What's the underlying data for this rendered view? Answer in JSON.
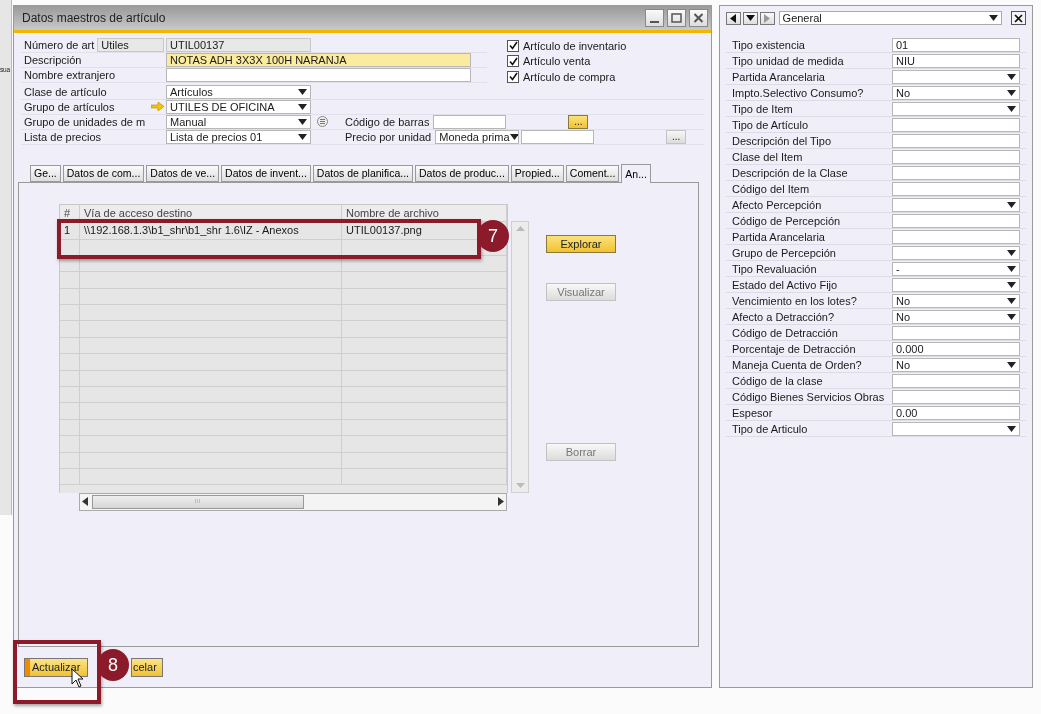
{
  "background_app": {
    "text": "sua"
  },
  "window": {
    "title": "Datos maestros de artículo"
  },
  "header": {
    "rows": [
      {
        "label": "Número de art",
        "code_field": {
          "value": "Utiles"
        },
        "field": {
          "kind": "readonly",
          "value": "UTIL00137"
        }
      },
      {
        "label": "Descripción",
        "field": {
          "kind": "required",
          "value": "NOTAS ADH 3X3X 100H NARANJA"
        }
      },
      {
        "label": "Nombre extranjero",
        "field": {
          "kind": "text"
        }
      },
      {
        "label": "Clase de artículo",
        "field": {
          "kind": "select",
          "value": "Artículos"
        }
      },
      {
        "label": "Grupo de artículos",
        "link_arrow": true,
        "field": {
          "kind": "select",
          "value": "UTILES DE OFICINA"
        }
      },
      {
        "label": "Grupo de unidades de m",
        "field": {
          "kind": "select",
          "value": "Manual"
        },
        "info_button": true,
        "extra": {
          "label": "Código de barras",
          "fields": [
            {
              "kind": "text"
            }
          ],
          "button": {
            "label": "...",
            "disabled": false
          }
        }
      },
      {
        "label": "Lista de precios",
        "field": {
          "kind": "select",
          "value": "Lista de precios 01"
        },
        "extra": {
          "label": "Precio por unidad",
          "fields": [
            {
              "kind": "select",
              "value": "Moneda prima"
            },
            {
              "kind": "text"
            }
          ],
          "button": {
            "label": "...",
            "disabled": true
          }
        }
      }
    ],
    "checkboxes": [
      {
        "label": "Artículo de inventario",
        "checked": true
      },
      {
        "label": "Artículo venta",
        "checked": true
      },
      {
        "label": "Artículo de compra",
        "checked": true
      }
    ]
  },
  "tabs": [
    {
      "label": "Ge...",
      "selected": false
    },
    {
      "label": "Datos de com...",
      "selected": false
    },
    {
      "label": "Datos de ve...",
      "selected": false
    },
    {
      "label": "Datos de invent...",
      "selected": false
    },
    {
      "label": "Datos de planifica...",
      "selected": false
    },
    {
      "label": "Datos de produc...",
      "selected": false
    },
    {
      "label": "Propied...",
      "selected": false
    },
    {
      "label": "Coment...",
      "selected": false
    },
    {
      "label": "An...",
      "selected": true
    }
  ],
  "attachments": {
    "columns": [
      "#",
      "Vía de acceso destino",
      "Nombre de archivo"
    ],
    "rows": [
      [
        "1",
        "\\\\192.168.1.3\\b1_shr\\b1_shr 1.6\\IZ - Anexos",
        "UTIL00137.png"
      ]
    ],
    "buttons": [
      {
        "label": "Explorar",
        "disabled": false
      },
      {
        "label": "Visualizar",
        "disabled": true
      },
      {
        "label": "Borrar",
        "disabled": true
      }
    ]
  },
  "footer_buttons": [
    {
      "label": "Actualizar",
      "focused": true
    },
    {
      "label": "celar",
      "focused": false
    }
  ],
  "callouts": [
    {
      "number": "7"
    },
    {
      "number": "8"
    }
  ],
  "side_panel": {
    "category": "General",
    "fields": [
      {
        "label": "Tipo existencia",
        "kind": "text",
        "value": "01"
      },
      {
        "label": "Tipo unidad de medida",
        "kind": "text",
        "value": "NIU"
      },
      {
        "label": "Partida Arancelaria",
        "kind": "select"
      },
      {
        "label": "Impto.Selectivo Consumo?",
        "kind": "select",
        "value": "No"
      },
      {
        "label": "Tipo de Item",
        "kind": "select"
      },
      {
        "label": "Tipo de Artículo",
        "kind": "text"
      },
      {
        "label": "Descripción del Tipo",
        "kind": "text"
      },
      {
        "label": "Clase del Item",
        "kind": "text"
      },
      {
        "label": "Descripción de la Clase",
        "kind": "text"
      },
      {
        "label": "Código del Item",
        "kind": "text"
      },
      {
        "label": "Afecto Percepción",
        "kind": "select"
      },
      {
        "label": "Código de Percepción",
        "kind": "text"
      },
      {
        "label": "Partida Arancelaria",
        "kind": "text"
      },
      {
        "label": "Grupo de Percepción",
        "kind": "select"
      },
      {
        "label": "Tipo Revaluación",
        "kind": "select",
        "value": "-"
      },
      {
        "label": "Estado del Activo Fijo",
        "kind": "select"
      },
      {
        "label": "Vencimiento en los lotes?",
        "kind": "select",
        "value": "No"
      },
      {
        "label": "Afecto a Detracción?",
        "kind": "select",
        "value": "No"
      },
      {
        "label": "Código de Detracción",
        "kind": "text"
      },
      {
        "label": "Porcentaje de Detracción",
        "kind": "text",
        "value": "0.000"
      },
      {
        "label": "Maneja Cuenta de Orden?",
        "kind": "select",
        "value": "No"
      },
      {
        "label": "Código de la clase",
        "kind": "text"
      },
      {
        "label": "Código Bienes Servicios Obras",
        "kind": "text"
      },
      {
        "label": "Espesor",
        "kind": "text",
        "value": "0.00"
      },
      {
        "label": "Tipo de Articulo",
        "kind": "select"
      }
    ]
  }
}
